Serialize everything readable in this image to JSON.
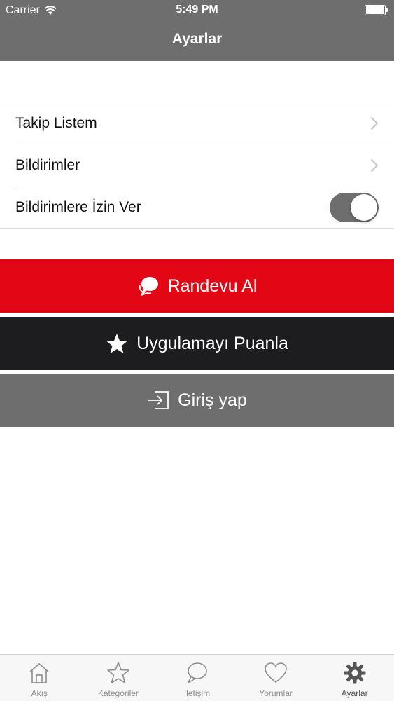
{
  "status_bar": {
    "carrier": "Carrier",
    "time": "5:49 PM"
  },
  "nav": {
    "title": "Ayarlar"
  },
  "settings": {
    "items": [
      {
        "label": "Takip Listem",
        "accessory": "chevron-right-icon"
      },
      {
        "label": "Bildirimler",
        "accessory": "chevron-right-icon"
      },
      {
        "label": "Bildirimlere İzin Ver",
        "accessory": "toggle",
        "enabled": true
      }
    ]
  },
  "actions": {
    "appointment": {
      "label": "Randevu Al",
      "icon": "chat-bubbles-icon",
      "color": "#e30614"
    },
    "rate": {
      "label": "Uygulamayı Puanla",
      "icon": "star-icon",
      "color": "#1d1d1f"
    },
    "login": {
      "label": "Giriş yap",
      "icon": "sign-in-icon",
      "color": "#6e6e6e"
    }
  },
  "tab_bar": {
    "tabs": [
      {
        "label": "Akış",
        "icon": "home-icon",
        "active": false
      },
      {
        "label": "Kategoriler",
        "icon": "star-outline-icon",
        "active": false
      },
      {
        "label": "İletişim",
        "icon": "chat-icon",
        "active": false
      },
      {
        "label": "Yorumlar",
        "icon": "heart-icon",
        "active": false
      },
      {
        "label": "Ayarlar",
        "icon": "gear-icon",
        "active": true
      }
    ]
  },
  "colors": {
    "header": "#6e6e6e",
    "accent_red": "#e30614",
    "dark": "#1d1d1f"
  }
}
